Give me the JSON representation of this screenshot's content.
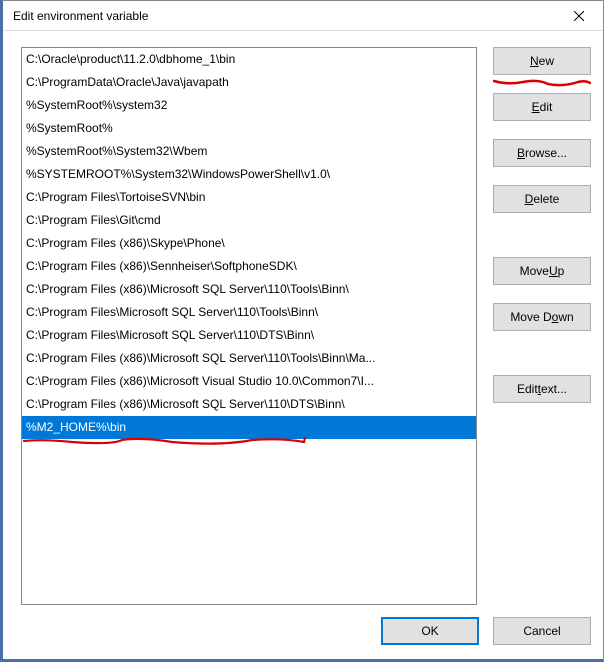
{
  "title": "Edit environment variable",
  "list_items": [
    "C:\\Oracle\\product\\11.2.0\\dbhome_1\\bin",
    "C:\\ProgramData\\Oracle\\Java\\javapath",
    "%SystemRoot%\\system32",
    "%SystemRoot%",
    "%SystemRoot%\\System32\\Wbem",
    "%SYSTEMROOT%\\System32\\WindowsPowerShell\\v1.0\\",
    "C:\\Program Files\\TortoiseSVN\\bin",
    "C:\\Program Files\\Git\\cmd",
    "C:\\Program Files (x86)\\Skype\\Phone\\",
    "C:\\Program Files (x86)\\Sennheiser\\SoftphoneSDK\\",
    "C:\\Program Files (x86)\\Microsoft SQL Server\\110\\Tools\\Binn\\",
    "C:\\Program Files\\Microsoft SQL Server\\110\\Tools\\Binn\\",
    "C:\\Program Files\\Microsoft SQL Server\\110\\DTS\\Binn\\",
    "C:\\Program Files (x86)\\Microsoft SQL Server\\110\\Tools\\Binn\\Ma...",
    "C:\\Program Files (x86)\\Microsoft Visual Studio 10.0\\Common7\\I...",
    "C:\\Program Files (x86)\\Microsoft SQL Server\\110\\DTS\\Binn\\",
    "%M2_HOME%\\bin"
  ],
  "selected_index": 16,
  "buttons": {
    "new_pre": "",
    "new_u": "N",
    "new_post": "ew",
    "edit_pre": "",
    "edit_u": "E",
    "edit_post": "dit",
    "browse_pre": "",
    "browse_u": "B",
    "browse_post": "rowse...",
    "delete_pre": "",
    "delete_u": "D",
    "delete_post": "elete",
    "moveup_pre": "Move ",
    "moveup_u": "U",
    "moveup_post": "p",
    "movedown_pre": "Move D",
    "movedown_u": "o",
    "movedown_post": "wn",
    "edittext_pre": "Edit ",
    "edittext_u": "t",
    "edittext_post": "ext...",
    "ok": "OK",
    "cancel": "Cancel"
  }
}
